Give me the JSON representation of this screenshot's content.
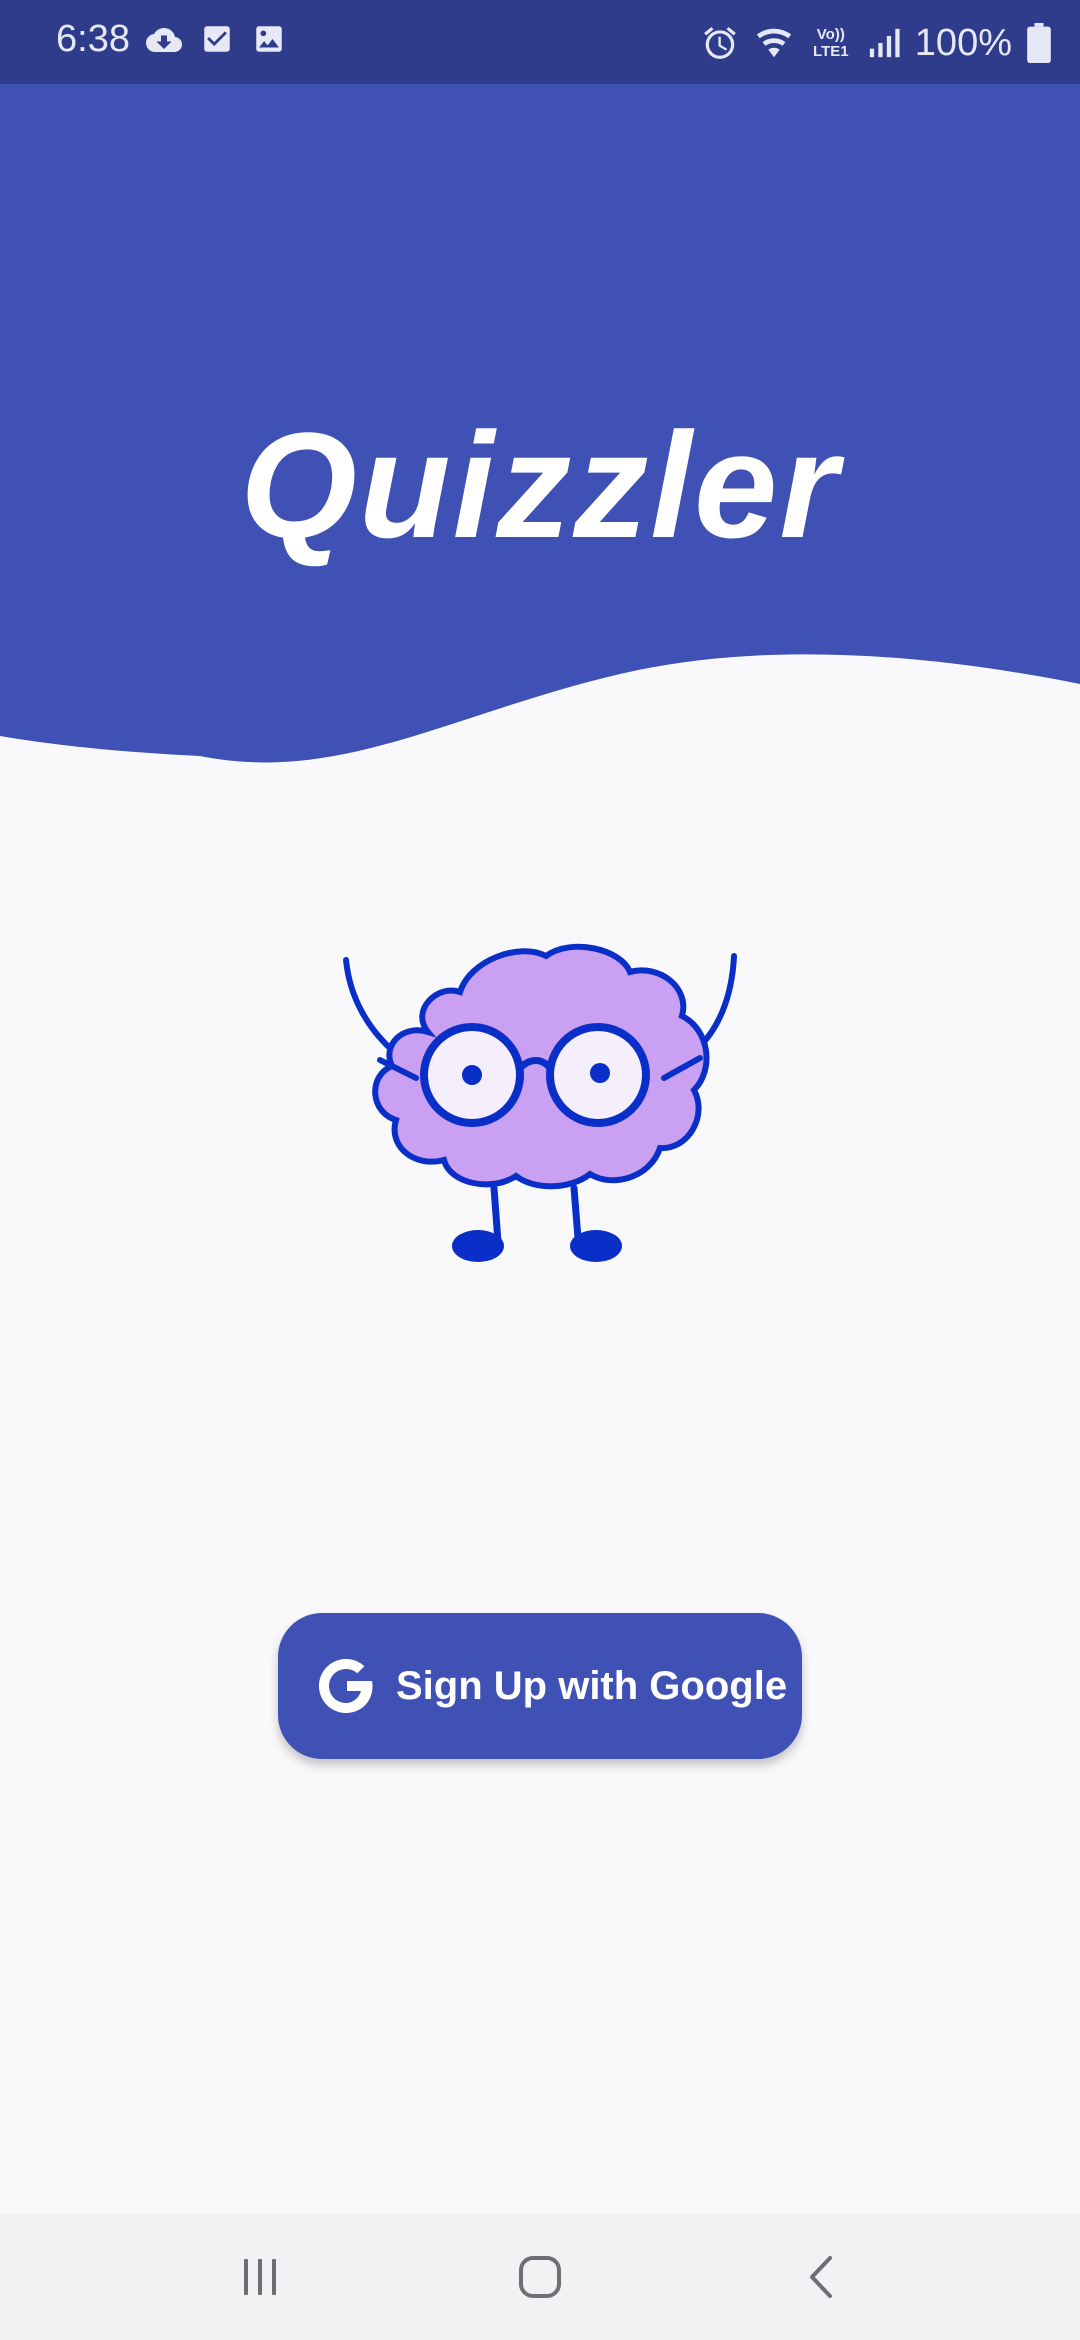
{
  "status_bar": {
    "time": "6:38",
    "battery": "100%",
    "left_icons": [
      "cloud-download-icon",
      "checkbox-icon",
      "image-icon"
    ],
    "right_icons": [
      "alarm-icon",
      "wifi-icon",
      "volte-icon",
      "signal-icon",
      "battery-icon"
    ],
    "volte_text": "Vo)) LTE1"
  },
  "header": {
    "title": "Quizzler",
    "background_color": "#3f51b5"
  },
  "mascot": {
    "icon": "brain-mascot-icon"
  },
  "sign_up_button": {
    "label": "Sign Up with Google",
    "icon": "google-icon",
    "color": "#3f51b5"
  },
  "nav_bar": {
    "buttons": [
      "recent-apps-icon",
      "home-icon",
      "back-icon"
    ]
  }
}
